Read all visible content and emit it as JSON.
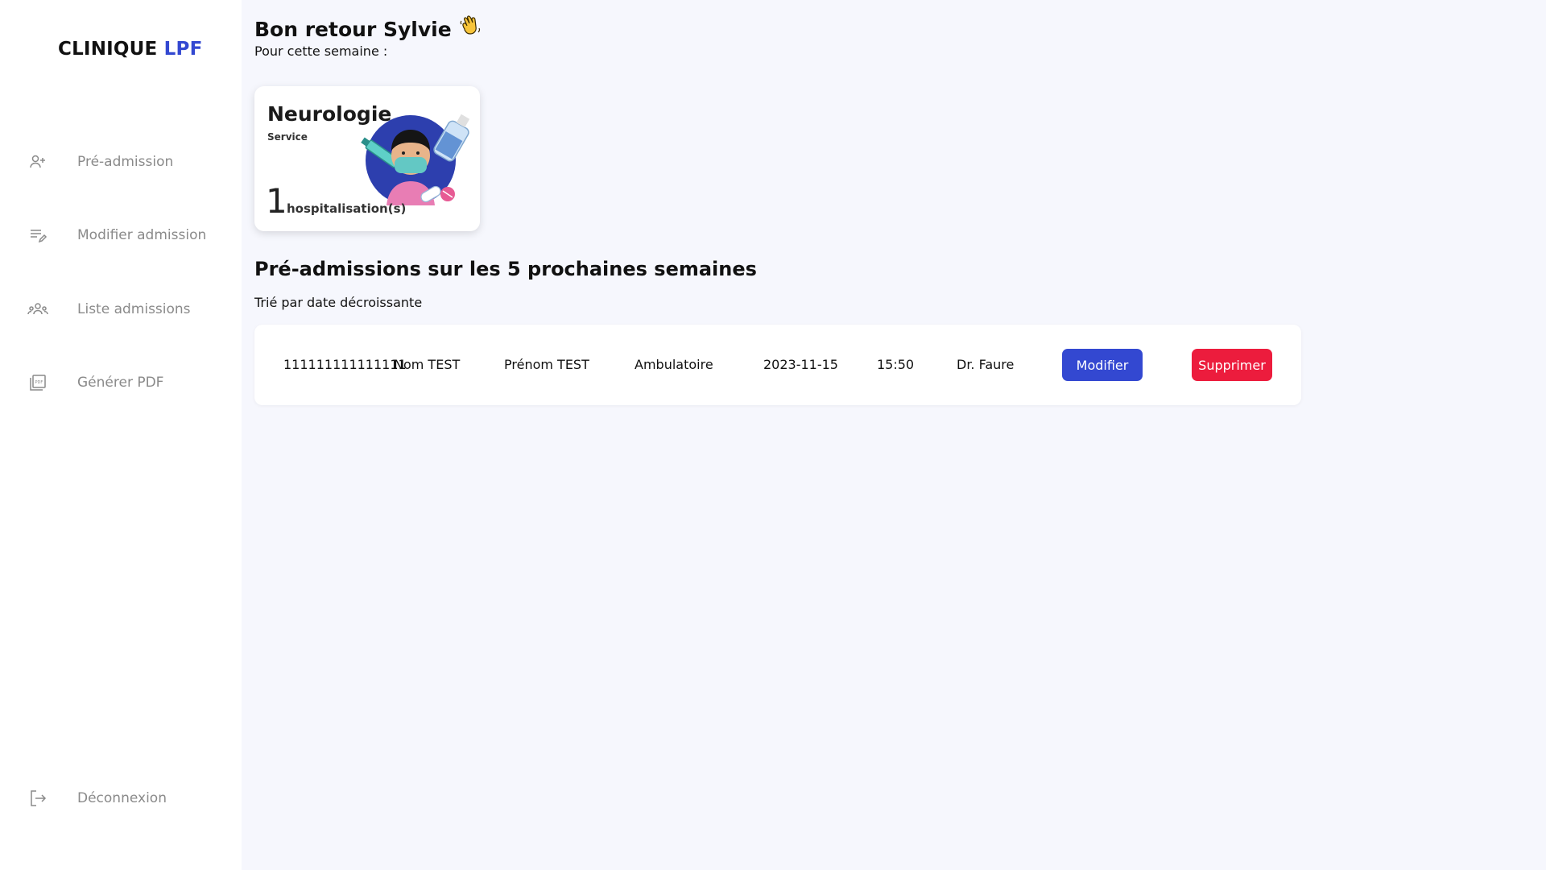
{
  "brand": {
    "name_part1": "CLINIQUE",
    "name_part2": "LPF",
    "accent_color": "#3348d1"
  },
  "sidebar": {
    "items": [
      {
        "label": "Pré-admission",
        "icon": "user-add-icon"
      },
      {
        "label": "Modifier admission",
        "icon": "list-edit-icon"
      },
      {
        "label": "Liste admissions",
        "icon": "users-group-icon"
      },
      {
        "label": "Générer PDF",
        "icon": "pdf-icon"
      }
    ],
    "logout": {
      "label": "Déconnexion",
      "icon": "logout-icon"
    }
  },
  "header": {
    "greeting": "Bon retour Sylvie",
    "greeting_icon": "waving-hand-icon",
    "subtitle": "Pour cette semaine :"
  },
  "service_card": {
    "title": "Neurologie",
    "subtitle": "Service",
    "count": "1",
    "count_label": "hospitalisation(s)",
    "illustration": "doctor-mask-illustration"
  },
  "admissions": {
    "title": "Pré-admissions sur les 5 prochaines semaines",
    "subtitle": "Trié par date décroissante",
    "rows": [
      {
        "id": "111111111111111",
        "nom": "Nom TEST",
        "prenom": "Prénom TEST",
        "type": "Ambulatoire",
        "date": "2023-11-15",
        "heure": "15:50",
        "medecin": "Dr. Faure",
        "edit_label": "Modifier",
        "delete_label": "Supprimer"
      }
    ]
  },
  "colors": {
    "primary": "#3348d1",
    "danger": "#ec1c3d",
    "background": "#f6f7fd"
  }
}
